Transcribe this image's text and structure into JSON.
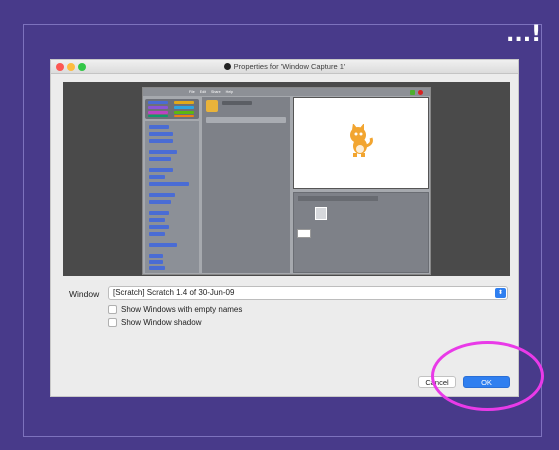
{
  "slide": {
    "title_snippet": "...!",
    "background_color": "#483a8a",
    "highlight_color": "#e93ae8"
  },
  "dialog": {
    "title": "Properties for 'Window Capture 1'",
    "window_label": "Window",
    "window_value": "[Scratch] Scratch 1.4 of 30-Jun-09",
    "show_empty_names_label": "Show Windows with empty names",
    "show_shadow_label": "Show Window shadow",
    "cancel_label": "Cancel",
    "ok_label": "OK",
    "accent_color": "#2f7ff0"
  },
  "scratch_preview": {
    "menu": [
      "File",
      "Edit",
      "Share",
      "Help"
    ]
  }
}
